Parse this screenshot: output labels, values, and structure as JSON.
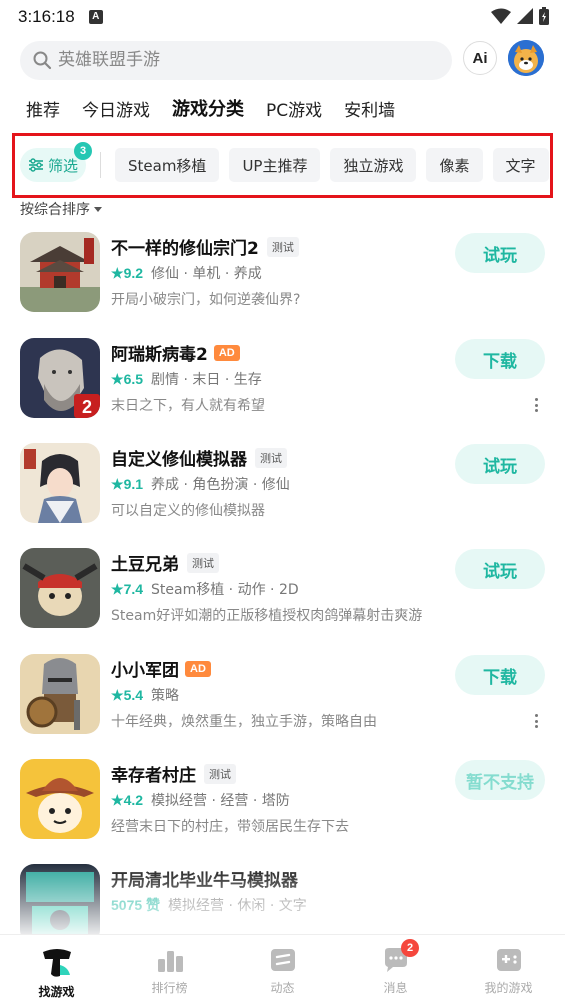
{
  "status": {
    "time": "3:16:18",
    "a_label": "A"
  },
  "search": {
    "placeholder": "英雄联盟手游",
    "ai_label": "Ai"
  },
  "tabs": [
    {
      "label": "推荐",
      "active": false
    },
    {
      "label": "今日游戏",
      "active": false
    },
    {
      "label": "游戏分类",
      "active": true
    },
    {
      "label": "PC游戏",
      "active": false
    },
    {
      "label": "安利墙",
      "active": false
    }
  ],
  "filter": {
    "label": "筛选",
    "badge": "3",
    "chips": [
      "Steam移植",
      "UP主推荐",
      "独立游戏",
      "像素",
      "文字"
    ]
  },
  "sort": {
    "label": "按综合排序"
  },
  "games": [
    {
      "title": "不一样的修仙宗门2",
      "tag": "测试",
      "ad": "",
      "rating": "9.2",
      "genres": "修仙 · 单机 · 养成",
      "desc": "开局小破宗门，如何逆袭仙界?",
      "action": "试玩",
      "more": false
    },
    {
      "title": "阿瑞斯病毒2",
      "tag": "",
      "ad": "AD",
      "rating": "6.5",
      "genres": "剧情 · 末日 · 生存",
      "desc": "末日之下，有人就有希望",
      "action": "下载",
      "more": true
    },
    {
      "title": "自定义修仙模拟器",
      "tag": "测试",
      "ad": "",
      "rating": "9.1",
      "genres": "养成 · 角色扮演 · 修仙",
      "desc": "可以自定义的修仙模拟器",
      "action": "试玩",
      "more": false
    },
    {
      "title": "土豆兄弟",
      "tag": "测试",
      "ad": "",
      "rating": "7.4",
      "genres": "Steam移植 · 动作 · 2D",
      "desc": "Steam好评如潮的正版移植授权肉鸽弹幕射击爽游",
      "action": "试玩",
      "more": false
    },
    {
      "title": "小小军团",
      "tag": "",
      "ad": "AD",
      "rating": "5.4",
      "genres": "策略",
      "desc": "十年经典，焕然重生，独立手游，策略自由",
      "action": "下载",
      "more": true
    },
    {
      "title": "幸存者村庄",
      "tag": "测试",
      "ad": "",
      "rating": "4.2",
      "genres": "模拟经营 · 经营 · 塔防",
      "desc": "经营末日下的村庄，带领居民生存下去",
      "action": "暂不支持",
      "more": false
    },
    {
      "title": "开局清北毕业牛马模拟器",
      "tag": "",
      "ad": "",
      "rating": "5075 赞",
      "genres": "模拟经营 · 休闲 · 文字",
      "desc": "",
      "action": "",
      "more": false
    }
  ],
  "nav": [
    {
      "label": "找游戏",
      "icon": "find-game-icon",
      "active": true,
      "badge": ""
    },
    {
      "label": "排行榜",
      "icon": "ranking-icon",
      "active": false,
      "badge": ""
    },
    {
      "label": "动态",
      "icon": "feed-icon",
      "active": false,
      "badge": ""
    },
    {
      "label": "消息",
      "icon": "message-icon",
      "active": false,
      "badge": "2"
    },
    {
      "label": "我的游戏",
      "icon": "my-games-icon",
      "active": false,
      "badge": ""
    }
  ],
  "colors": {
    "accent": "#1fb7a1",
    "highlight": "#49d6c2",
    "frame": "#e4141a",
    "ad": "#ff8a3d",
    "badge": "#f5473d"
  }
}
